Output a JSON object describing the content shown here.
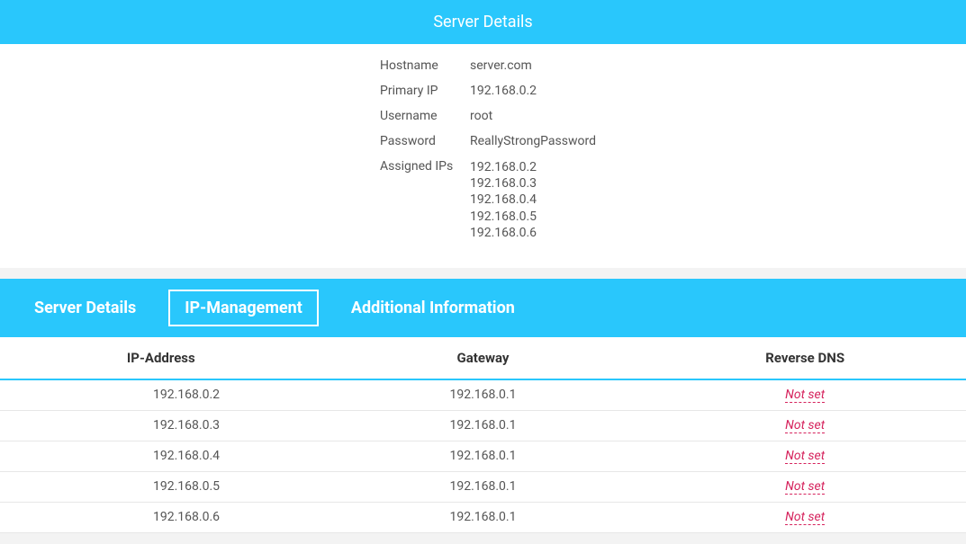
{
  "panel_title": "Server Details",
  "details": {
    "hostname_label": "Hostname",
    "hostname_value": "server.com",
    "primary_ip_label": "Primary IP",
    "primary_ip_value": "192.168.0.2",
    "username_label": "Username",
    "username_value": "root",
    "password_label": "Password",
    "password_value": "ReallyStrongPassword",
    "assigned_ips_label": "Assigned IPs",
    "assigned_ips": [
      "192.168.0.2",
      "192.168.0.3",
      "192.168.0.4",
      "192.168.0.5",
      "192.168.0.6"
    ]
  },
  "tabs": {
    "server_details": "Server Details",
    "ip_management": "IP-Management",
    "additional_info": "Additional Information"
  },
  "ip_table": {
    "headers": {
      "ip": "IP-Address",
      "gateway": "Gateway",
      "rdns": "Reverse DNS"
    },
    "rows": [
      {
        "ip": "192.168.0.2",
        "gateway": "192.168.0.1",
        "rdns": "Not set"
      },
      {
        "ip": "192.168.0.3",
        "gateway": "192.168.0.1",
        "rdns": "Not set"
      },
      {
        "ip": "192.168.0.4",
        "gateway": "192.168.0.1",
        "rdns": "Not set"
      },
      {
        "ip": "192.168.0.5",
        "gateway": "192.168.0.1",
        "rdns": "Not set"
      },
      {
        "ip": "192.168.0.6",
        "gateway": "192.168.0.1",
        "rdns": "Not set"
      }
    ]
  }
}
